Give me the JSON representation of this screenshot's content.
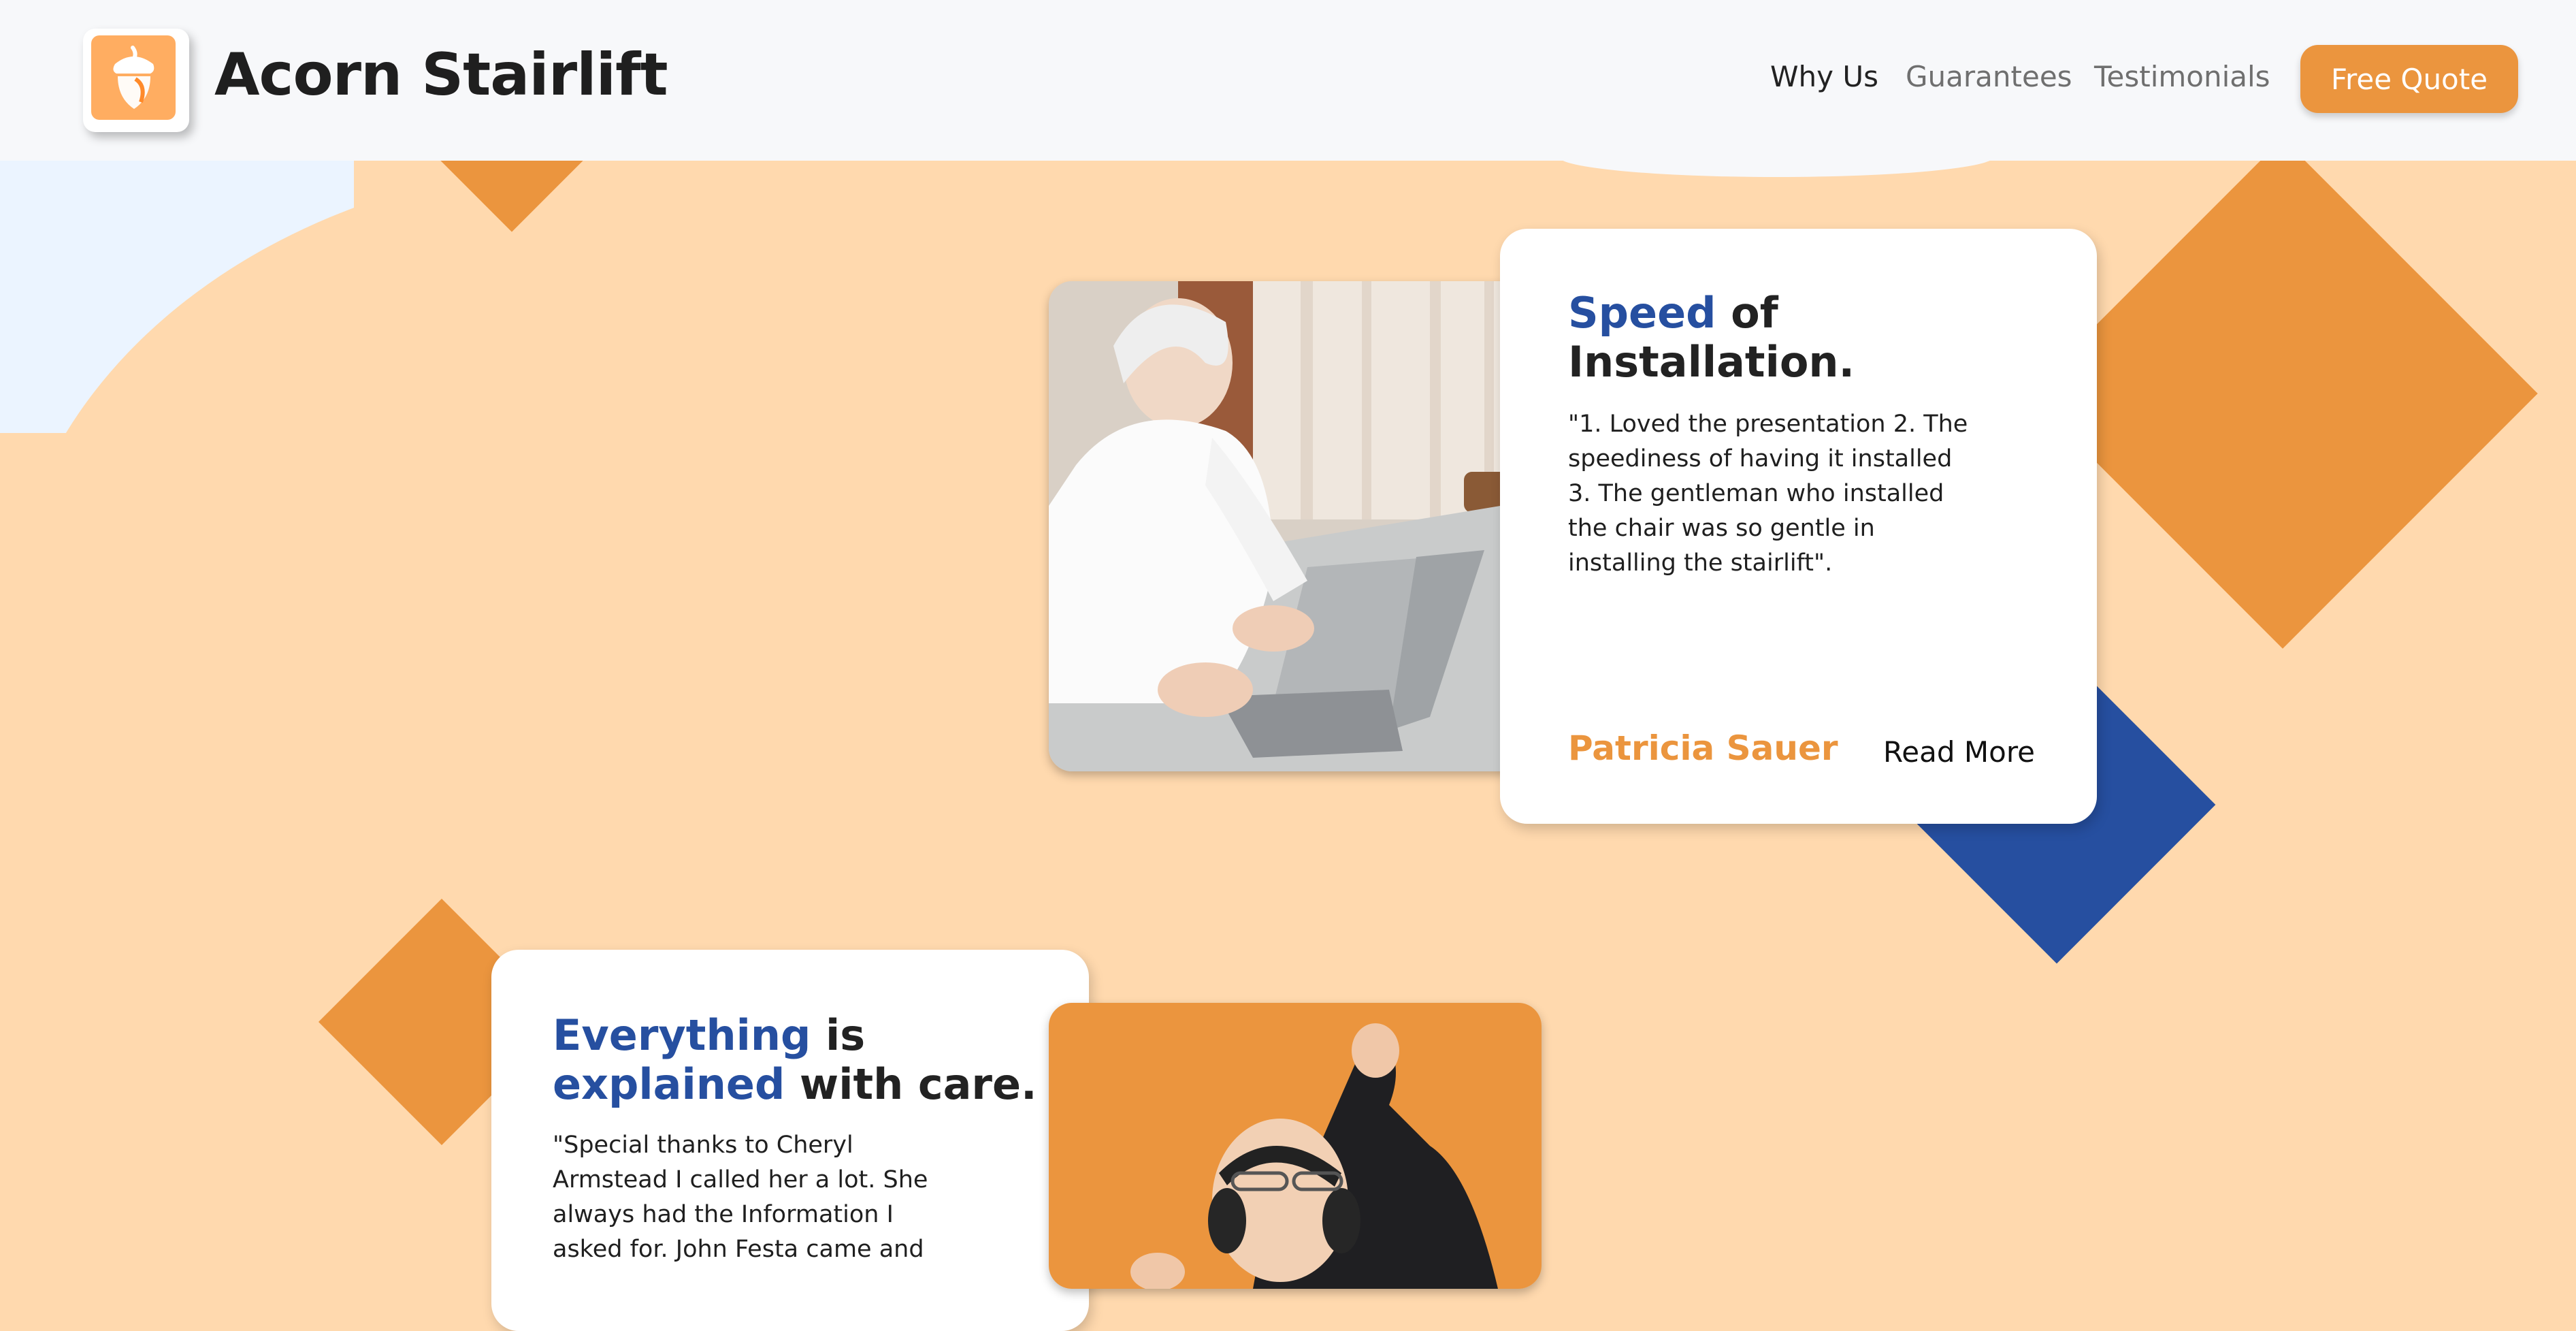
{
  "brand": {
    "name": "Acorn Stairlift",
    "logo_icon": "acorn-icon"
  },
  "nav": {
    "items": [
      {
        "label": "Why Us",
        "active": true
      },
      {
        "label": "Guarantees",
        "active": false
      },
      {
        "label": "Testimonials",
        "active": false
      }
    ],
    "cta_label": "Free Quote"
  },
  "colors": {
    "accent_orange": "#eb953e",
    "accent_blue": "#264fa0",
    "background_peach": "#ffd9ae",
    "header_bg": "#f7f8fa"
  },
  "testimonials": [
    {
      "title_highlight": "Speed",
      "title_rest": " of",
      "title_line2": "Installation.",
      "quote_lines": [
        "\"1. Loved the presentation 2. The",
        "speediness of having it installed",
        "3. The gentleman who installed",
        "the chair was so gentle in",
        "installing the stairlift\"."
      ],
      "author": "Patricia Sauer",
      "read_more": "Read More",
      "photo": "elderly-woman-using-laptop"
    },
    {
      "title_line1_highlight": "Everything",
      "title_line1_rest": " is",
      "title_line2_highlight": "explained",
      "title_line2_rest": " with care.",
      "quote_lines": [
        "\"Special thanks to Cheryl",
        "Armstead I called her a lot. She",
        "always had the Information I",
        "asked for. John Festa came and"
      ],
      "photo": "elderly-man-with-headphones"
    }
  ]
}
